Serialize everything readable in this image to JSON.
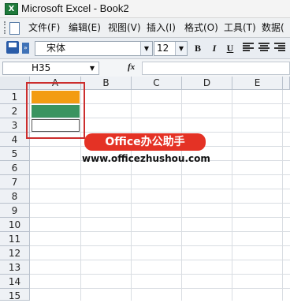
{
  "window": {
    "title": "Microsoft Excel - Book2"
  },
  "menu": [
    {
      "label": "文件(F)"
    },
    {
      "label": "编辑(E)"
    },
    {
      "label": "视图(V)"
    },
    {
      "label": "插入(I)"
    },
    {
      "label": "格式(O)"
    },
    {
      "label": "工具(T)"
    },
    {
      "label": "数据("
    }
  ],
  "toolbar": {
    "font": "宋体",
    "size": "12",
    "bold_label": "B",
    "italic_label": "I",
    "underline_label": "U"
  },
  "formula_bar": {
    "name_box": "H35",
    "fx_label": "fx",
    "formula": ""
  },
  "sheet": {
    "columns": [
      "A",
      "B",
      "C",
      "D",
      "E"
    ],
    "rows": [
      "1",
      "2",
      "3",
      "4",
      "5",
      "6",
      "7",
      "8",
      "9",
      "10",
      "11",
      "12",
      "13",
      "14",
      "15"
    ],
    "cells": [
      {
        "ref": "A1",
        "fill": "#f39c12"
      },
      {
        "ref": "A2",
        "fill": "#3a9460"
      },
      {
        "ref": "A3",
        "fill": "#ffffff"
      }
    ],
    "selection_outline_color": "#cc2e2e"
  },
  "watermark": {
    "badge": "Office办公助手",
    "url": "www.officezhushou.com",
    "badge_color": "#e43225"
  }
}
